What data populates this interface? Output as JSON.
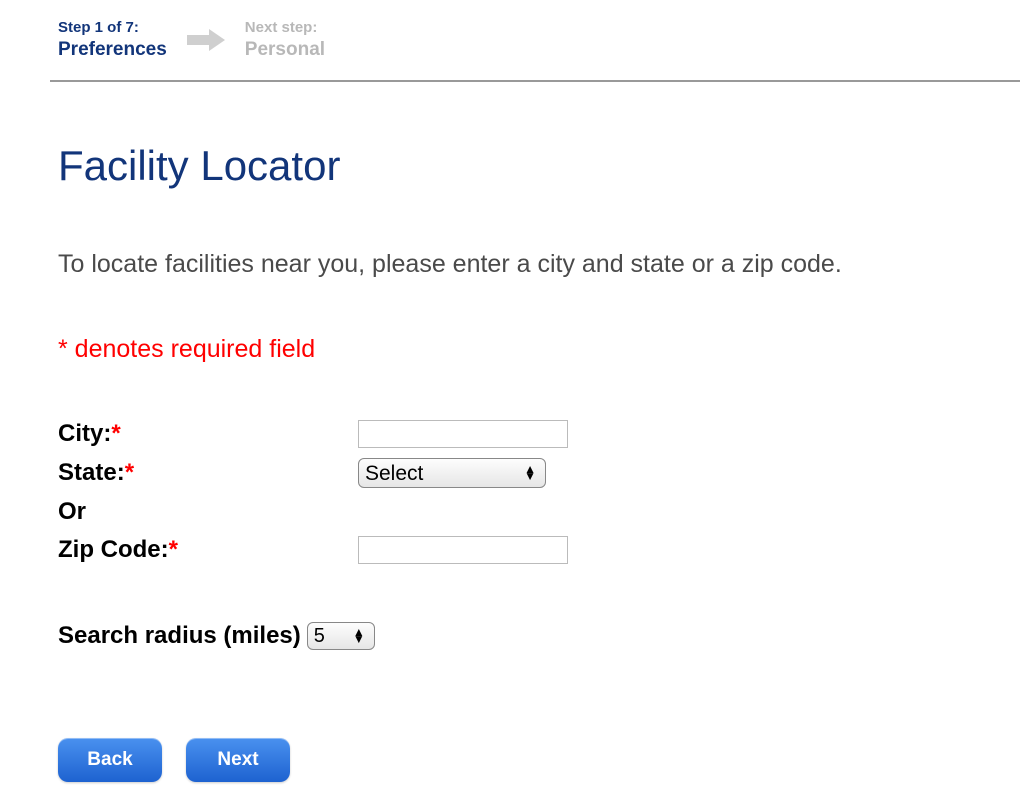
{
  "stepper": {
    "current_step_num": "Step 1 of 7:",
    "current_step_name": "Preferences",
    "next_step_label": "Next step:",
    "next_step_name": "Personal"
  },
  "page": {
    "title": "Facility Locator",
    "intro": "To locate facilities near you, please enter a city and state or a zip code.",
    "required_note": "* denotes required field"
  },
  "form": {
    "city_label": "City:",
    "city_value": "",
    "state_label": "State:",
    "state_selected": "Select",
    "or_label": "Or",
    "zip_label": "Zip Code:",
    "zip_value": "",
    "radius_label": "Search radius (miles)",
    "radius_selected": "5"
  },
  "buttons": {
    "back": "Back",
    "next": "Next"
  }
}
